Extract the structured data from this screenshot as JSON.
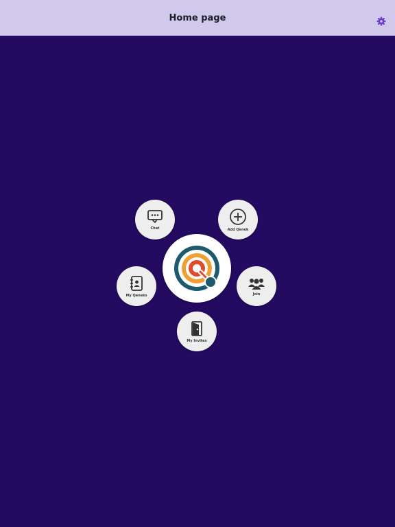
{
  "header": {
    "title": "Home page",
    "settings_icon": "gear-icon"
  },
  "menu": {
    "chat": {
      "label": "Chat",
      "icon": "chat-bubble-icon"
    },
    "add": {
      "label": "Add Qenek",
      "icon": "plus-circle-icon"
    },
    "my_qeneks": {
      "label": "My Qeneks",
      "icon": "address-book-icon"
    },
    "join": {
      "label": "Join",
      "icon": "group-icon"
    },
    "invites": {
      "label": "My Invites",
      "icon": "invite-door-icon"
    }
  },
  "logo": {
    "icon": "q-target-logo-icon"
  },
  "colors": {
    "background": "#250a61",
    "navbar": "#d1c9ec",
    "bubble": "#eeeeee",
    "accent": "#6a3fc8",
    "logo_teal": "#1e5a6e",
    "logo_orange": "#f0a033",
    "logo_red": "#e24a2c"
  }
}
